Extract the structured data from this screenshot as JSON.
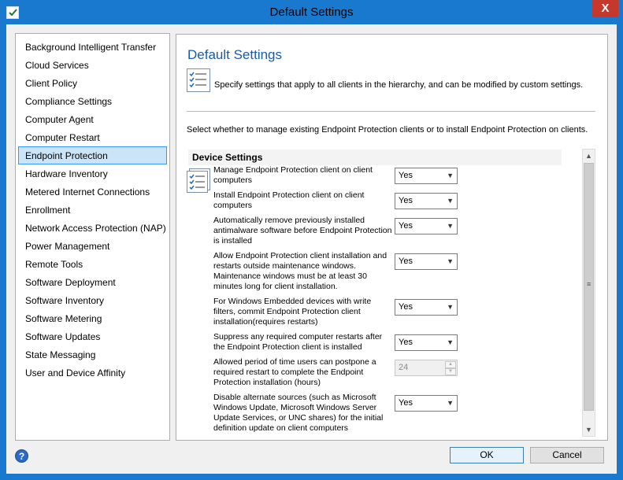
{
  "window": {
    "title": "Default Settings",
    "close_label": "X"
  },
  "nav": {
    "items": [
      {
        "label": "Background Intelligent Transfer",
        "selected": false
      },
      {
        "label": "Cloud Services",
        "selected": false
      },
      {
        "label": "Client Policy",
        "selected": false
      },
      {
        "label": "Compliance Settings",
        "selected": false
      },
      {
        "label": "Computer Agent",
        "selected": false
      },
      {
        "label": "Computer Restart",
        "selected": false
      },
      {
        "label": "Endpoint Protection",
        "selected": true
      },
      {
        "label": "Hardware Inventory",
        "selected": false
      },
      {
        "label": "Metered Internet Connections",
        "selected": false
      },
      {
        "label": "Enrollment",
        "selected": false
      },
      {
        "label": "Network Access Protection (NAP)",
        "selected": false
      },
      {
        "label": "Power Management",
        "selected": false
      },
      {
        "label": "Remote Tools",
        "selected": false
      },
      {
        "label": "Software Deployment",
        "selected": false
      },
      {
        "label": "Software Inventory",
        "selected": false
      },
      {
        "label": "Software Metering",
        "selected": false
      },
      {
        "label": "Software Updates",
        "selected": false
      },
      {
        "label": "State Messaging",
        "selected": false
      },
      {
        "label": "User and Device Affinity",
        "selected": false
      }
    ]
  },
  "panel": {
    "title": "Default Settings",
    "description": "Specify settings that apply to all clients in the hierarchy, and can be modified by custom settings.",
    "instruction": "Select whether to manage existing Endpoint Protection clients or to install Endpoint Protection on clients.",
    "group_header": "Device Settings",
    "settings": [
      {
        "label": "Manage Endpoint Protection client on client computers",
        "value": "Yes",
        "type": "combo"
      },
      {
        "label": "Install Endpoint Protection client on client computers",
        "value": "Yes",
        "type": "combo"
      },
      {
        "label": "Automatically remove previously installed antimalware software before Endpoint Protection is installed",
        "value": "Yes",
        "type": "combo"
      },
      {
        "label": "Allow Endpoint Protection client installation and restarts outside maintenance windows. Maintenance windows must be at least 30 minutes long for client installation.",
        "value": "Yes",
        "type": "combo"
      },
      {
        "label": "For Windows Embedded devices with write filters, commit Endpoint Protection client installation(requires restarts)",
        "value": "Yes",
        "type": "combo"
      },
      {
        "label": "Suppress any required computer restarts after the Endpoint Protection client is installed",
        "value": "Yes",
        "type": "combo"
      },
      {
        "label": "Allowed period of time users can postpone a required restart to complete the Endpoint Protection installation (hours)",
        "value": "24",
        "type": "spin"
      },
      {
        "label": "Disable alternate sources (such as Microsoft Windows Update, Microsoft Windows Server Update Services, or UNC shares) for the initial definition update on client computers",
        "value": "Yes",
        "type": "combo"
      }
    ]
  },
  "buttons": {
    "ok": "OK",
    "cancel": "Cancel",
    "help": "?"
  },
  "colors": {
    "title_bar": "#1979cf",
    "close_button": "#c7382c",
    "selected_item": "#cce4f7",
    "panel_title": "#1b5aa6"
  }
}
